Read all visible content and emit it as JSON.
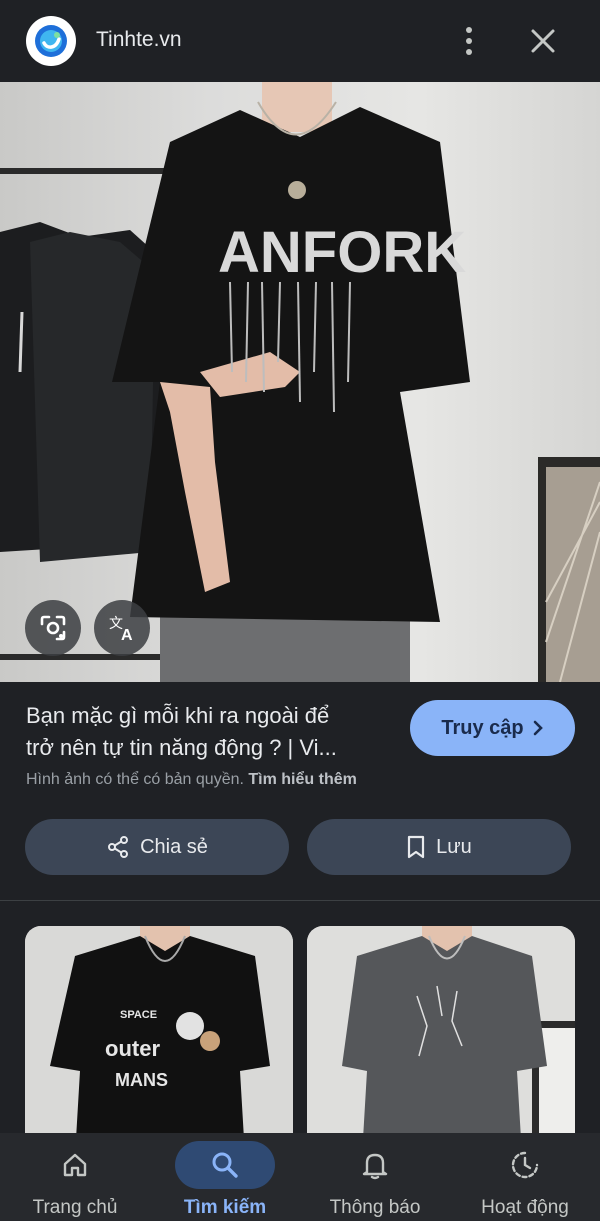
{
  "header": {
    "site_name": "Tinhte.vn",
    "logo_icon": "tinhte-logo-icon",
    "more_icon": "more-vertical-icon",
    "close_icon": "close-icon"
  },
  "image": {
    "print_text": "ANFORK",
    "lens_icon": "google-lens-icon",
    "translate_icon": "translate-icon"
  },
  "result": {
    "title_line1": "Bạn mặc gì mỗi khi ra ngoài để",
    "title_line2": "trở nên tự tin năng động ? | Vi...",
    "visit_label": "Truy cập",
    "copyright_text": "Hình ảnh có thể có bản quyền.",
    "learn_more": "Tìm hiểu thêm"
  },
  "actions": {
    "share_label": "Chia sẻ",
    "save_label": "Lưu"
  },
  "related": [
    {
      "print_text_1": "SPACE",
      "print_text_2": "outer",
      "print_text_3": "MANS",
      "color": "#111111"
    },
    {
      "color": "#55575a"
    }
  ],
  "nav": {
    "items": [
      {
        "label": "Trang chủ",
        "icon": "home-icon"
      },
      {
        "label": "Tìm kiếm",
        "icon": "search-icon",
        "active": true
      },
      {
        "label": "Thông báo",
        "icon": "bell-icon"
      },
      {
        "label": "Hoạt động",
        "icon": "activity-icon"
      }
    ]
  },
  "colors": {
    "background": "#1f2125",
    "accent": "#8ab4f8",
    "pill": "#3c4656"
  }
}
